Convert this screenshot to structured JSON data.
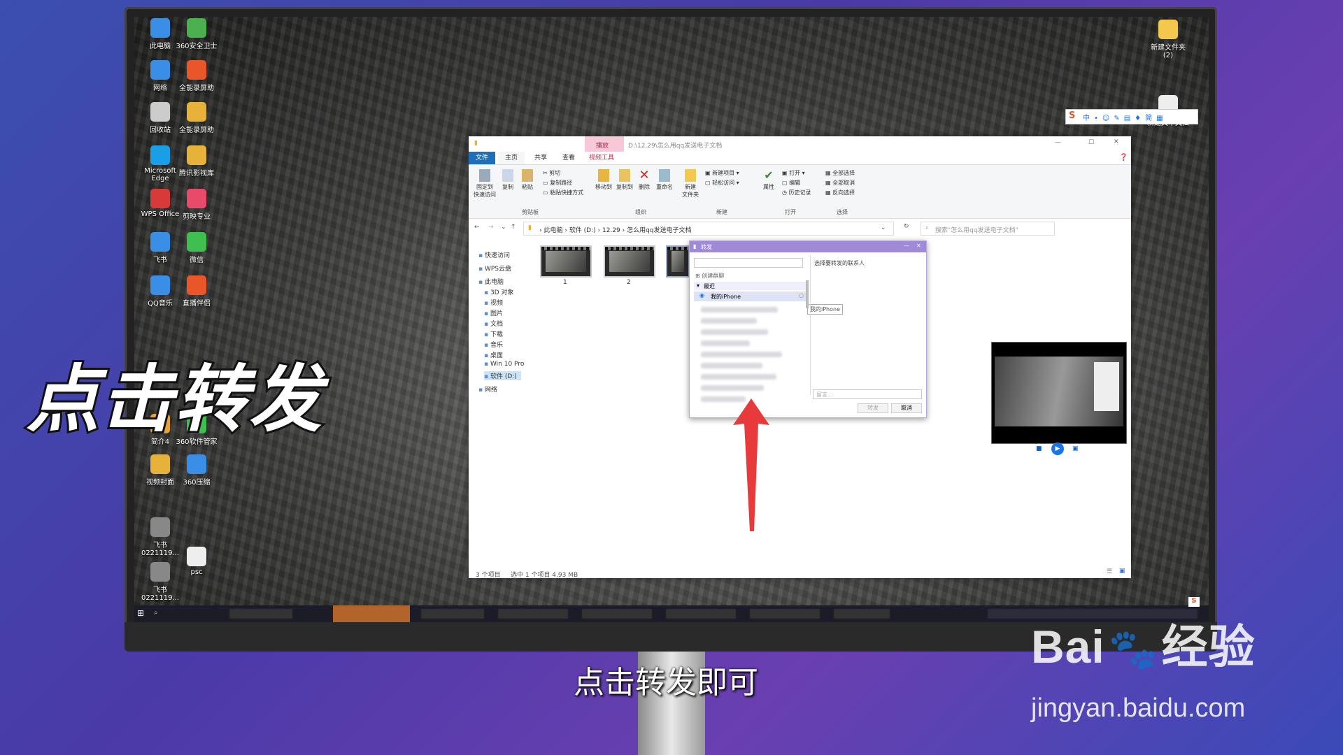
{
  "overlay": {
    "big_title": "点击转发",
    "subtitle": "点击转发即可",
    "watermark_brand": "Bai",
    "watermark_brand2": "经验",
    "watermark_url": "jingyan.baidu.com"
  },
  "desktop_icons": [
    "此电脑",
    "360安全卫士",
    "网络",
    "全能录屏助",
    "回收站",
    "全能录屏助",
    "Microsoft Edge",
    "腾讯影视库",
    "WPS Office",
    "剪映专业",
    "飞书",
    "微信",
    "QQ音乐",
    "直播伴侣",
    "简介4",
    "360软件管家",
    "视频封面",
    "360压缩",
    "飞书 0221119...",
    "飞书 0221119...",
    "psc"
  ],
  "desktop_right_icons": [
    "新建文件夹 (2)",
    "新建文本文档"
  ],
  "explorer": {
    "title_path": "D:\\12.29\\怎么用qq发送电子文档",
    "context_tab": "播放",
    "context_group": "视频工具",
    "tabs": [
      "文件",
      "主页",
      "共享",
      "查看"
    ],
    "ribbon": {
      "pin": "固定到\n快速访问",
      "copy": "复制",
      "paste": "粘贴",
      "cut": "剪切",
      "copy_path": "复制路径",
      "paste_shortcut": "粘贴快捷方式",
      "clipboard": "剪贴板",
      "move_to": "移动到",
      "copy_to": "复制到",
      "delete": "删除",
      "rename": "重命名",
      "organize": "组织",
      "new_folder": "新建\n文件夹",
      "new_item": "新建项目",
      "easy_access": "轻松访问",
      "new": "新建",
      "properties": "属性",
      "open": "打开",
      "edit": "编辑",
      "history": "历史记录",
      "open_group": "打开",
      "select_all": "全部选择",
      "select_none": "全部取消",
      "invert": "反向选择",
      "select_group": "选择"
    },
    "breadcrumb": [
      "此电脑",
      "软件 (D:)",
      "12.29",
      "怎么用qq发送电子文档"
    ],
    "search_placeholder": "搜索\"怎么用qq发送电子文档\"",
    "nav": [
      "快速访问",
      "WPS云盘",
      "此电脑",
      "3D 对象",
      "视频",
      "图片",
      "文档",
      "下载",
      "音乐",
      "桌面",
      "Win 10 Pro",
      "软件 (D:)",
      "网络"
    ],
    "files": [
      "1",
      "2"
    ],
    "status": {
      "count": "3 个项目",
      "selected": "选中 1 个项目  4.93 MB"
    }
  },
  "dialog": {
    "title": "转发",
    "create_group": "创建群聊",
    "recent": "最近",
    "my_iphone": "我的iPhone",
    "tooltip": "我的iPhone",
    "right_label": "选择要转发的联系人",
    "message_placeholder": "留言...",
    "forward_button": "转发",
    "cancel_button": "取消"
  },
  "colors": {
    "accent": "#1a73e8",
    "dialog_title": "#a08ad8",
    "arrow": "#e83a3a",
    "file_tab": "#1c6fb8"
  }
}
